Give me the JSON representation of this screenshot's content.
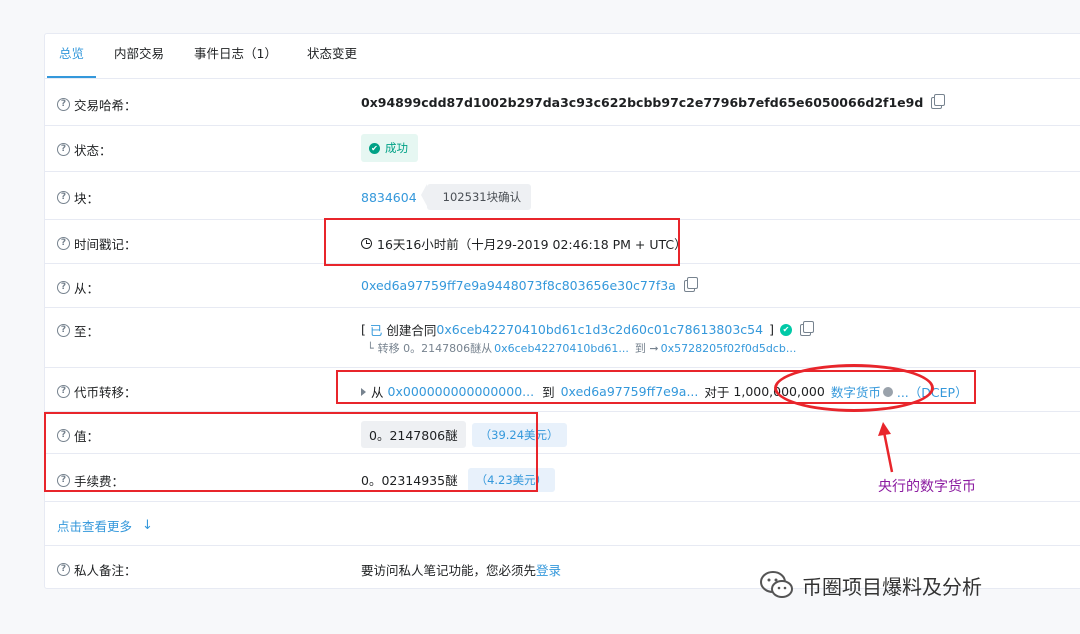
{
  "tabs": [
    {
      "label": "总览",
      "active": true
    },
    {
      "label": "内部交易"
    },
    {
      "label": "事件日志（1）"
    },
    {
      "label": "状态变更"
    }
  ],
  "rows": {
    "tx_hash": {
      "label": "交易哈希：",
      "value": "0x94899cdd87d1002b297da3c93c622bcbb97c2e7796b7efd65e6050066d2f1e9d"
    },
    "status": {
      "label": "状态：",
      "value": "成功"
    },
    "block": {
      "label": "块：",
      "number": "8834604",
      "confirmations": "102531块确认"
    },
    "timestamp": {
      "label": "时间戳记：",
      "value": "16天16小时前（十月29-2019 02:46:18 PM + UTC）"
    },
    "from": {
      "label": "从：",
      "value": "0xed6a97759ff7e9a9448073f8c803656e30c77f3a"
    },
    "to": {
      "label": "至：",
      "prefix": "[",
      "created": "已",
      "created_text": "创建合同",
      "contract": "0x6ceb42270410bd61c1d3c2d60c01c78613803c54",
      "suffix": "]",
      "sub_transfer": "转移 0。2147806醚从",
      "sub_from": "0x6ceb42270410bd61...",
      "sub_to_text": "到 ➞",
      "sub_to": "0x5728205f02f0d5dcb..."
    },
    "token": {
      "label": "代币转移：",
      "from_text": "从",
      "from_addr": "0x000000000000000...",
      "to_text": "到",
      "to_addr": "0xed6a97759ff7e9a...",
      "for_text": "对于",
      "amount": "1,000,000,000",
      "token_name": "数字货币",
      "token_symbol": "...（DCEP）"
    },
    "value": {
      "label": "值：",
      "value": "0。2147806醚",
      "usd": "（39.24美元）"
    },
    "fee": {
      "label": "手续费：",
      "value": "0。02314935醚",
      "usd": "（4.23美元）"
    },
    "more": {
      "label": "点击查看更多"
    },
    "note": {
      "label": "私人备注：",
      "text": "要访问私人笔记功能，您必须先",
      "link": "登录"
    }
  },
  "annotation": "央行的数字货币",
  "watermark": "币圈项目爆料及分析",
  "colors": {
    "accent": "#3498db",
    "success": "#00a186",
    "annotation_red": "#e8252b",
    "annotation_purple": "#8b1aa0"
  }
}
